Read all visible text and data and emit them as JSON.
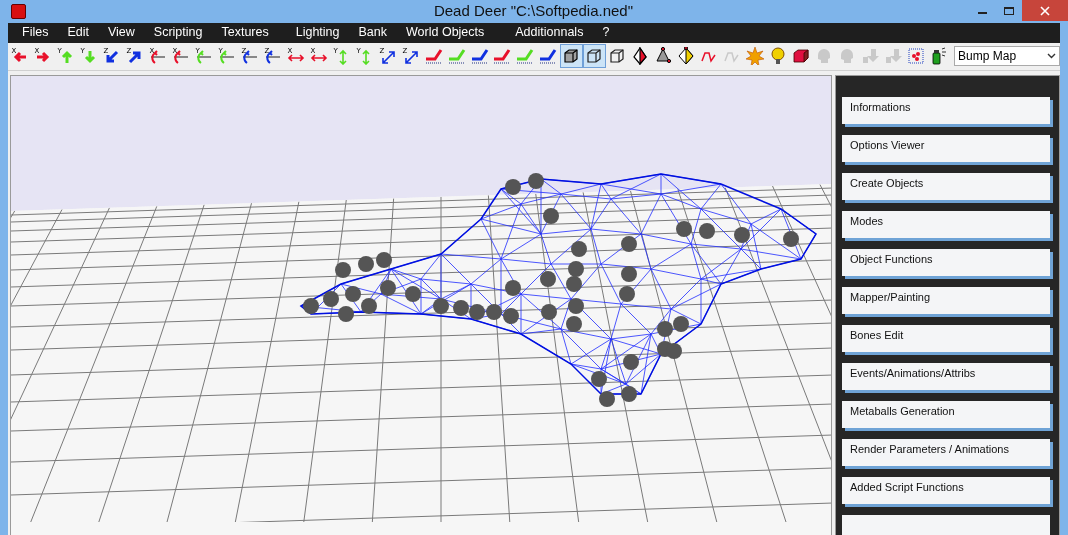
{
  "window": {
    "title": "Dead Deer \"C:\\Softpedia.ned\""
  },
  "menu": [
    "Files",
    "Edit",
    "View",
    "Scripting",
    "Textures",
    "Lighting",
    "Bank",
    "World Objects",
    "Additionnals",
    "?"
  ],
  "toolbar": {
    "tools": [
      {
        "kind": "move-left",
        "axis": "X",
        "color": "#e8102a",
        "selected": false,
        "disabled": false
      },
      {
        "kind": "move-right",
        "axis": "X",
        "color": "#e8102a",
        "selected": false,
        "disabled": false
      },
      {
        "kind": "move-up",
        "axis": "Y",
        "color": "#55dd22",
        "selected": false,
        "disabled": false
      },
      {
        "kind": "move-down",
        "axis": "Y",
        "color": "#55dd22",
        "selected": false,
        "disabled": false
      },
      {
        "kind": "move-diag-down",
        "axis": "Z",
        "color": "#1030e0",
        "selected": false,
        "disabled": false
      },
      {
        "kind": "move-diag-up",
        "axis": "Z",
        "color": "#1030e0",
        "selected": false,
        "disabled": false
      },
      {
        "kind": "rotate",
        "axis": "X",
        "color": "#e8102a",
        "selected": false,
        "disabled": false
      },
      {
        "kind": "rotate",
        "axis": "X",
        "color": "#e8102a",
        "selected": false,
        "disabled": false
      },
      {
        "kind": "rotate",
        "axis": "Y",
        "color": "#55dd22",
        "selected": false,
        "disabled": false
      },
      {
        "kind": "rotate",
        "axis": "Y",
        "color": "#55dd22",
        "selected": false,
        "disabled": false
      },
      {
        "kind": "rotate",
        "axis": "Z",
        "color": "#1030e0",
        "selected": false,
        "disabled": false
      },
      {
        "kind": "rotate",
        "axis": "Z",
        "color": "#1030e0",
        "selected": false,
        "disabled": false
      },
      {
        "kind": "scale-h",
        "axis": "X",
        "color": "#e8102a",
        "selected": false,
        "disabled": false
      },
      {
        "kind": "scale-h",
        "axis": "X",
        "color": "#e8102a",
        "selected": false,
        "disabled": false
      },
      {
        "kind": "scale-v",
        "axis": "Y",
        "color": "#55dd22",
        "selected": false,
        "disabled": false
      },
      {
        "kind": "scale-v",
        "axis": "Y",
        "color": "#55dd22",
        "selected": false,
        "disabled": false
      },
      {
        "kind": "scale-diag",
        "axis": "Z",
        "color": "#1030e0",
        "selected": false,
        "disabled": false
      },
      {
        "kind": "scale-diag",
        "axis": "Z",
        "color": "#1030e0",
        "selected": false,
        "disabled": false
      },
      {
        "kind": "bend",
        "color": "#e8102a",
        "selected": false,
        "disabled": false
      },
      {
        "kind": "bend",
        "color": "#55dd22",
        "selected": false,
        "disabled": false
      },
      {
        "kind": "bend",
        "color": "#1030e0",
        "selected": false,
        "disabled": false
      },
      {
        "kind": "bend",
        "color": "#e8102a",
        "selected": false,
        "disabled": false
      },
      {
        "kind": "bend",
        "color": "#55dd22",
        "selected": false,
        "disabled": false
      },
      {
        "kind": "bend",
        "color": "#1030e0",
        "selected": false,
        "disabled": false
      },
      {
        "kind": "cube-shaded",
        "selected": true,
        "disabled": false
      },
      {
        "kind": "cube",
        "selected": true,
        "disabled": false
      },
      {
        "kind": "cube",
        "selected": false,
        "disabled": false
      },
      {
        "kind": "tetra",
        "selected": false,
        "disabled": false
      },
      {
        "kind": "pyramid",
        "selected": false,
        "disabled": false
      },
      {
        "kind": "diamond",
        "color": "#f0d000",
        "selected": false,
        "disabled": false
      },
      {
        "kind": "curve",
        "color": "#e8102a",
        "selected": false,
        "disabled": false
      },
      {
        "kind": "curve",
        "selected": false,
        "disabled": true
      },
      {
        "kind": "burst",
        "color": "#f0a000",
        "selected": false,
        "disabled": false
      },
      {
        "kind": "bulb",
        "color": "#f0d000",
        "selected": false,
        "disabled": false
      },
      {
        "kind": "box",
        "color": "#e01040",
        "selected": false,
        "disabled": false
      },
      {
        "kind": "head",
        "selected": false,
        "disabled": true
      },
      {
        "kind": "head",
        "selected": false,
        "disabled": true
      },
      {
        "kind": "arrow-box",
        "selected": false,
        "disabled": true
      },
      {
        "kind": "arrow-box",
        "selected": false,
        "disabled": true
      },
      {
        "kind": "points",
        "selected": false,
        "disabled": false
      },
      {
        "kind": "spray",
        "color": "#20a020",
        "selected": false,
        "disabled": false
      }
    ],
    "dropdown": {
      "value": "Bump Map"
    }
  },
  "panel": {
    "buttons": [
      "Informations",
      "Options Viewer",
      "Create Objects",
      "Modes",
      "Object Functions",
      "Mapper/Painting",
      "Bones Edit",
      "Events/Animations/Attribs",
      "Metaballs Generation",
      "Render Parameters / Animations",
      "Added Script Functions"
    ]
  }
}
